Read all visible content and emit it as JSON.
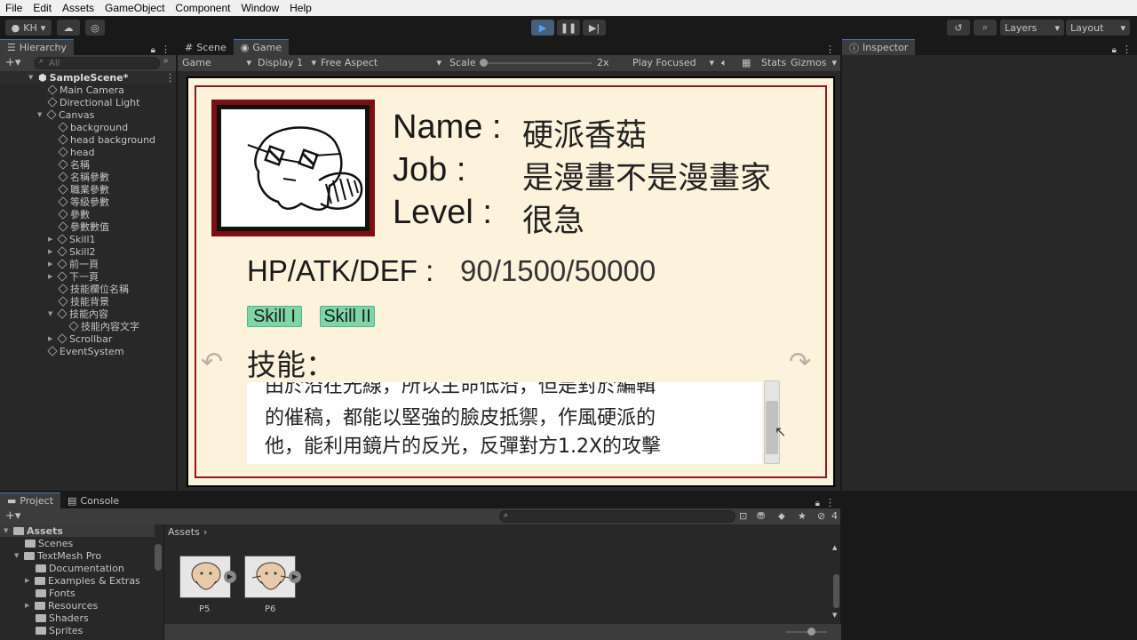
{
  "menu": [
    "File",
    "Edit",
    "Assets",
    "GameObject",
    "Component",
    "Window",
    "Help"
  ],
  "toolbar": {
    "account": "KH",
    "layers": "Layers",
    "layout": "Layout"
  },
  "hierarchy": {
    "tab": "Hierarchy",
    "search_placeholder": "All",
    "scene": "SampleScene*",
    "items": [
      {
        "label": "Main Camera"
      },
      {
        "label": "Directional Light"
      },
      {
        "label": "Canvas"
      },
      {
        "label": "background"
      },
      {
        "label": "head background"
      },
      {
        "label": "head"
      },
      {
        "label": "名稱"
      },
      {
        "label": "名稱參數"
      },
      {
        "label": "職業參數"
      },
      {
        "label": "等級參數"
      },
      {
        "label": "參數"
      },
      {
        "label": "參數數值"
      },
      {
        "label": "Skill1"
      },
      {
        "label": "Skill2"
      },
      {
        "label": "前一頁"
      },
      {
        "label": "下一頁"
      },
      {
        "label": "技能欄位名稱"
      },
      {
        "label": "技能背景"
      },
      {
        "label": "技能內容"
      },
      {
        "label": "技能內容文字"
      },
      {
        "label": "Scrollbar"
      },
      {
        "label": "EventSystem"
      }
    ]
  },
  "scene_tabs": {
    "scene": "Scene",
    "game": "Game"
  },
  "game_toolbar": {
    "mode": "Game",
    "display": "Display 1",
    "aspect": "Free Aspect",
    "scale_label": "Scale",
    "scale_value": "2x",
    "play_mode": "Play Focused",
    "stats": "Stats",
    "gizmos": "Gizmos"
  },
  "inspector": {
    "tab": "Inspector"
  },
  "card": {
    "name_label": "Name :",
    "name_value": "硬派香菇",
    "job_label": "Job :",
    "job_value": "是漫畫不是漫畫家",
    "level_label": "Level :",
    "level_value": "很急",
    "stats_label": "HP/ATK/DEF :",
    "stats_value": "90/1500/50000",
    "skill1": "Skill I",
    "skill2": "Skill II",
    "skill_title": "技能：",
    "skill_lines": [
      "由於沿在光線，所以主命低沿，但是對於編輯",
      "的催稿，都能以堅強的臉皮抵禦，作風硬派的",
      "他，能利用鏡片的反光，反彈對方1.2X的攻擊"
    ],
    "scroll_fraction": 0.65
  },
  "bottom": {
    "project_tab": "Project",
    "console_tab": "Console",
    "assets_root": "Assets",
    "folders": [
      {
        "label": "Scenes"
      },
      {
        "label": "TextMesh Pro"
      },
      {
        "label": "Documentation"
      },
      {
        "label": "Examples & Extras"
      },
      {
        "label": "Fonts"
      },
      {
        "label": "Resources"
      },
      {
        "label": "Shaders"
      },
      {
        "label": "Sprites"
      }
    ],
    "breadcrumb": "Assets",
    "badge": "4",
    "assets": [
      {
        "label": "P5"
      },
      {
        "label": "P6"
      }
    ]
  }
}
